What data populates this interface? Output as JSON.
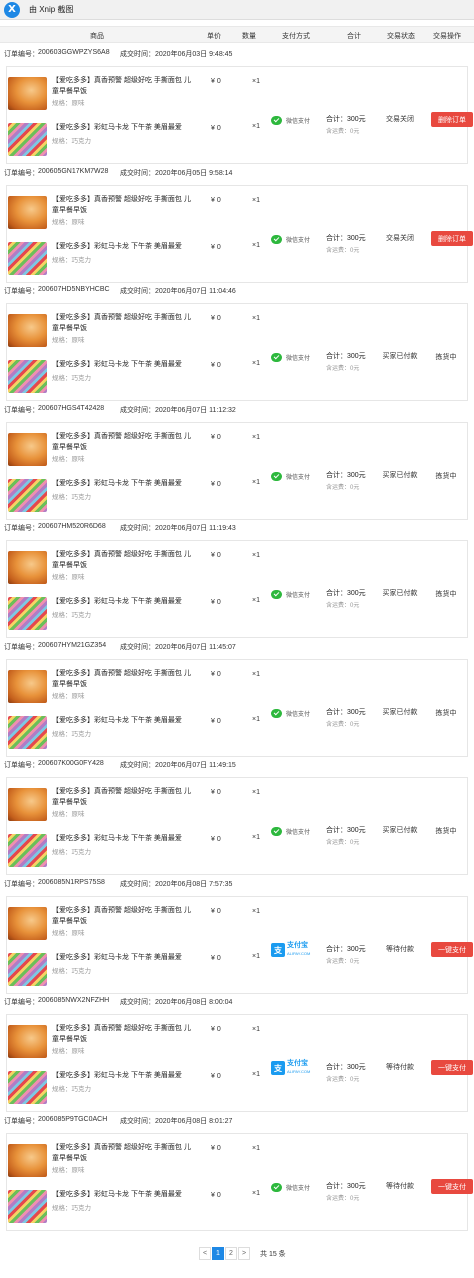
{
  "app": {
    "title": "由 Xnip 截图",
    "logo": "X"
  },
  "columns": {
    "product": "商品",
    "unit_price": "单价",
    "quantity": "数量",
    "payment": "支付方式",
    "total": "合计",
    "status": "交易状态",
    "action": "交易操作"
  },
  "labels": {
    "order_no": "订单编号：",
    "deal_time": "成交时间："
  },
  "products": [
    {
      "name": "【爱吃多多】真香预警 超级好吃 手撕面包 儿童早餐早饭",
      "spec": "规格：原味",
      "price": "¥ 0",
      "qty": "×1"
    },
    {
      "name": "【爱吃多多】彩虹马卡龙 下午茶 美眉最爱",
      "spec": "规格：巧克力",
      "price": "¥ 0",
      "qty": "×1"
    }
  ],
  "payments": {
    "wechat": {
      "label": "微信支付",
      "color": "#2db83d"
    },
    "alipay": {
      "label": "支付宝",
      "sub": "ALIPAY.COM",
      "glyph": "支",
      "color": "#1a9bf0"
    }
  },
  "orders": [
    {
      "id": "200603GGWPZYS6A8",
      "time": "2020年06月03日 9:48:45",
      "payment": "wechat",
      "total": "合计：300元",
      "freight": "含运费：0元",
      "status": "交易关闭",
      "action": "删除订单",
      "action_type": "button"
    },
    {
      "id": "200605GN17KM7W28",
      "time": "2020年06月05日 9:58:14",
      "payment": "wechat",
      "total": "合计：300元",
      "freight": "含运费：0元",
      "status": "交易关闭",
      "action": "删除订单",
      "action_type": "button"
    },
    {
      "id": "200607HD5NBYHCBC",
      "time": "2020年06月07日 11:04:46",
      "payment": "wechat",
      "total": "合计：300元",
      "freight": "含运费：0元",
      "status": "买家已付款",
      "action": "拣货中",
      "action_type": "text"
    },
    {
      "id": "200607HGS4T42428",
      "time": "2020年06月07日 11:12:32",
      "payment": "wechat",
      "total": "合计：300元",
      "freight": "含运费：0元",
      "status": "买家已付款",
      "action": "拣货中",
      "action_type": "text"
    },
    {
      "id": "200607HM520R6D68",
      "time": "2020年06月07日 11:19:43",
      "payment": "wechat",
      "total": "合计：300元",
      "freight": "含运费：0元",
      "status": "买家已付款",
      "action": "拣货中",
      "action_type": "text"
    },
    {
      "id": "200607HYM21GZ354",
      "time": "2020年06月07日 11:45:07",
      "payment": "wechat",
      "total": "合计：300元",
      "freight": "含运费：0元",
      "status": "买家已付款",
      "action": "拣货中",
      "action_type": "text"
    },
    {
      "id": "200607K00G0FY428",
      "time": "2020年06月07日 11:49:15",
      "payment": "wechat",
      "total": "合计：300元",
      "freight": "含运费：0元",
      "status": "买家已付款",
      "action": "拣货中",
      "action_type": "text"
    },
    {
      "id": "2006085N1RPS75S8",
      "time": "2020年06月08日 7:57:35",
      "payment": "alipay",
      "total": "合计：300元",
      "freight": "含运费：0元",
      "status": "等待付款",
      "action": "一键支付",
      "action_type": "button"
    },
    {
      "id": "2006085NWX2NFZHH",
      "time": "2020年06月08日 8:00:04",
      "payment": "alipay",
      "total": "合计：300元",
      "freight": "含运费：0元",
      "status": "等待付款",
      "action": "一键支付",
      "action_type": "button"
    },
    {
      "id": "2006085P9TGC0ACH",
      "time": "2020年06月08日 8:01:27",
      "payment": "wechat",
      "total": "合计：300元",
      "freight": "含运费：0元",
      "status": "等待付款",
      "action": "一键支付",
      "action_type": "button"
    }
  ],
  "pagination": {
    "prev": "<",
    "pages": [
      "1",
      "2"
    ],
    "current": "1",
    "next": ">",
    "total": "共 15 条"
  },
  "colors": {
    "accent": "#1e88e5",
    "danger_button": "#e8493f",
    "muted_text": "#999999"
  }
}
